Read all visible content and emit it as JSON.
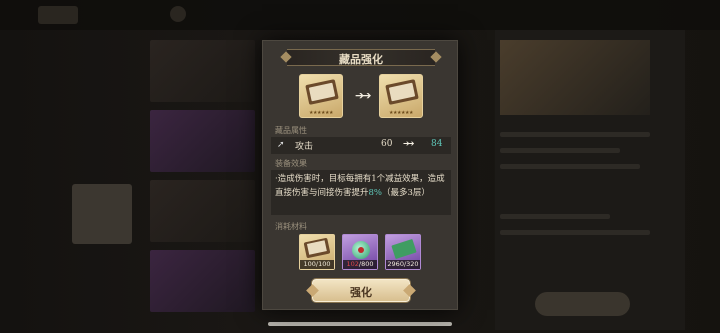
{
  "modal": {
    "title": "藏品强化",
    "relic_before": {
      "stars": "★★★★★★"
    },
    "relic_after": {
      "stars": "★★★★★★"
    },
    "upgrade_arrow": "➔➔",
    "attributes_label": "藏品属性",
    "attribute": {
      "name": "攻击",
      "old_value": "60",
      "arrow": "➔➔",
      "new_value": "84"
    },
    "effect_label": "装备效果",
    "effect": {
      "part1": "·造成伤害时，目标每拥有1个减益效果，造成直接伤害与间接伤害提升",
      "percent": "8%",
      "part2": "（最多3层）"
    },
    "materials_label": "消耗材料",
    "materials": [
      {
        "type": "relic-book",
        "have": "100",
        "sep": "/",
        "need": "100",
        "insufficient": false
      },
      {
        "type": "green-gem",
        "have": "102",
        "sep": "/",
        "need": "800",
        "insufficient": true
      },
      {
        "type": "green-note",
        "have": "2960",
        "sep": "/",
        "need": "320",
        "insufficient": false
      }
    ],
    "confirm_label": "强化"
  },
  "colors": {
    "accent_teal": "#5fc7b9",
    "insufficient_red": "#e04848",
    "button_gold": "#e6d1a6"
  }
}
